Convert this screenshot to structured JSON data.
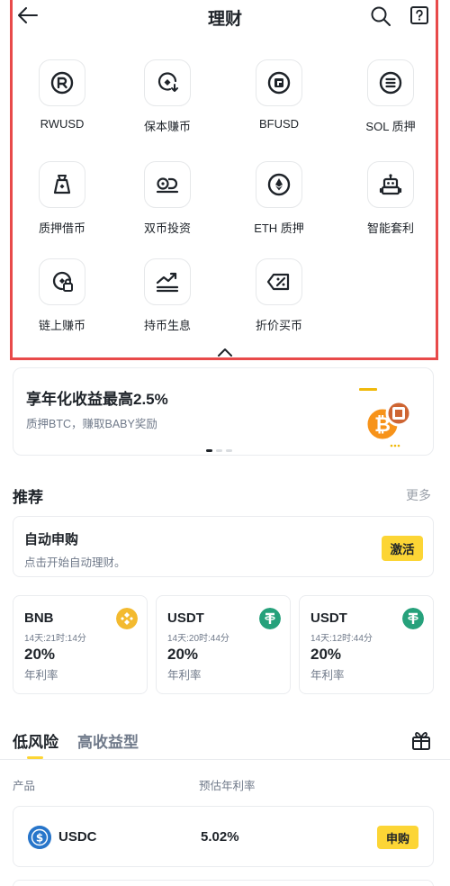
{
  "header": {
    "title": "理财"
  },
  "grid": [
    {
      "label": "RWUSD",
      "icon": "rwusd-icon"
    },
    {
      "label": "保本赚币",
      "icon": "principal-protected-icon"
    },
    {
      "label": "BFUSD",
      "icon": "bfusd-icon"
    },
    {
      "label": "SOL 质押",
      "icon": "sol-staking-icon"
    },
    {
      "label": "质押借币",
      "icon": "loan-bag-icon"
    },
    {
      "label": "双币投资",
      "icon": "dual-investment-icon"
    },
    {
      "label": "ETH 质押",
      "icon": "eth-icon"
    },
    {
      "label": "智能套利",
      "icon": "robot-icon"
    },
    {
      "label": "链上赚币",
      "icon": "onchain-earn-icon"
    },
    {
      "label": "持币生息",
      "icon": "trend-up-icon"
    },
    {
      "label": "折价买币",
      "icon": "discount-tag-icon"
    }
  ],
  "banner": {
    "title": "享年化收益最高2.5%",
    "subtitle": "质押BTC，赚取BABY奖励"
  },
  "recommend": {
    "title": "推荐",
    "more": "更多",
    "auto": {
      "title": "自动申购",
      "subtitle": "点击开始自动理财。",
      "button": "激活"
    },
    "products": [
      {
        "name": "BNB",
        "period": "14天:21时:14分",
        "rate": "20%",
        "rate_label": "年利率",
        "color": "#f3ba2f"
      },
      {
        "name": "USDT",
        "period": "14天:20时:44分",
        "rate": "20%",
        "rate_label": "年利率",
        "color": "#26a17b"
      },
      {
        "name": "USDT",
        "period": "14天:12时:44分",
        "rate": "20%",
        "rate_label": "年利率",
        "color": "#26a17b"
      }
    ]
  },
  "tabs": {
    "low_risk": "低风险",
    "high_yield": "高收益型"
  },
  "table": {
    "col_product": "产品",
    "col_rate": "预估年利率",
    "rows": [
      {
        "name": "USDC",
        "rate": "5.02%",
        "button": "申购"
      }
    ]
  },
  "colors": {
    "accent": "#fcd535",
    "highlight": "#e84a4a"
  }
}
